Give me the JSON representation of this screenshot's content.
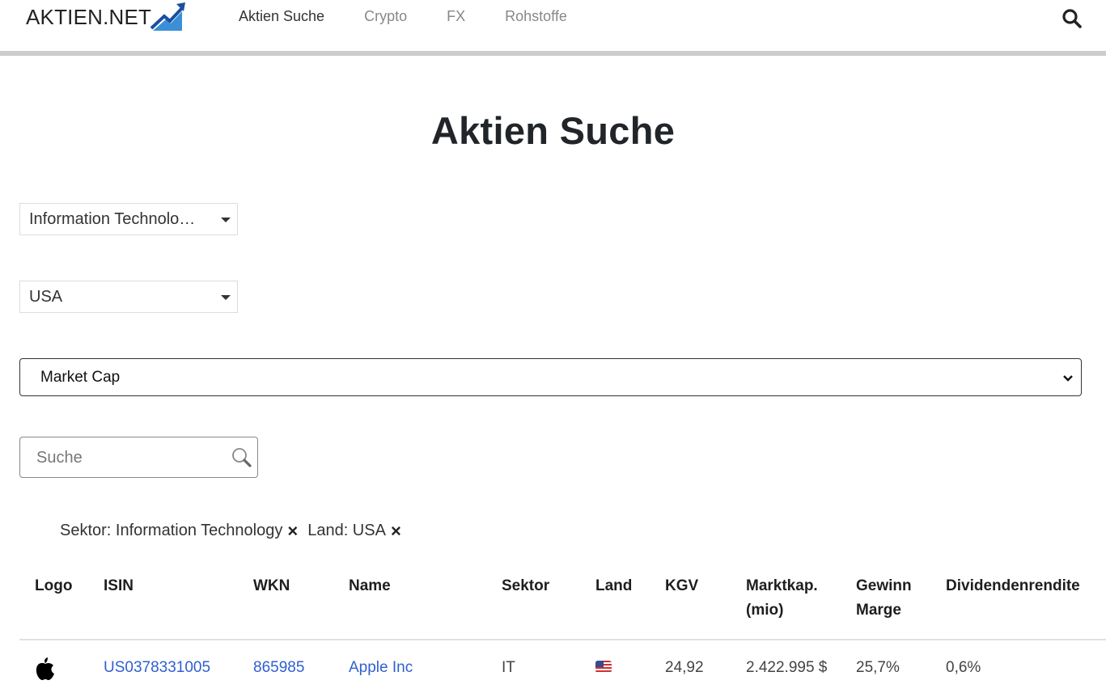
{
  "header": {
    "brand": "AKTIEN.NET",
    "nav": [
      {
        "label": "Aktien Suche",
        "active": true
      },
      {
        "label": "Crypto",
        "active": false
      },
      {
        "label": "FX",
        "active": false
      },
      {
        "label": "Rohstoffe",
        "active": false
      }
    ],
    "search_icon": "search-icon"
  },
  "page": {
    "title": "Aktien Suche"
  },
  "filters": {
    "sektor_select": "Information Technolo…",
    "land_select": "USA",
    "sort_select": "Market Cap",
    "search_placeholder": "Suche",
    "search_value": "",
    "active_chips": [
      {
        "label": "Sektor: Information Technology",
        "remove": "×"
      },
      {
        "label": "Land: USA",
        "remove": "×"
      }
    ]
  },
  "table": {
    "headers": {
      "logo": "Logo",
      "isin": "ISIN",
      "wkn": "WKN",
      "name": "Name",
      "sektor": "Sektor",
      "land": "Land",
      "kgv": "KGV",
      "marktkap_line1": "Marktkap.",
      "marktkap_line2": "(mio)",
      "gewinn_line1": "Gewinn",
      "gewinn_line2": "Marge",
      "dividende": "Dividendenrendite"
    },
    "rows": [
      {
        "logo": "apple-logo",
        "isin": "US0378331005",
        "wkn": "865985",
        "name": "Apple Inc",
        "sektor": "IT",
        "land": "us-flag",
        "kgv": "24,92",
        "marktkap": "2.422.995 $",
        "gewinn_marge": "25,7%",
        "dividendenrendite": "0,6%"
      }
    ]
  },
  "colors": {
    "link": "#2f5fd0",
    "logo_dark_blue": "#1a4fa0",
    "logo_light_blue": "#3a8fd8",
    "header_border": "#cccccc"
  }
}
